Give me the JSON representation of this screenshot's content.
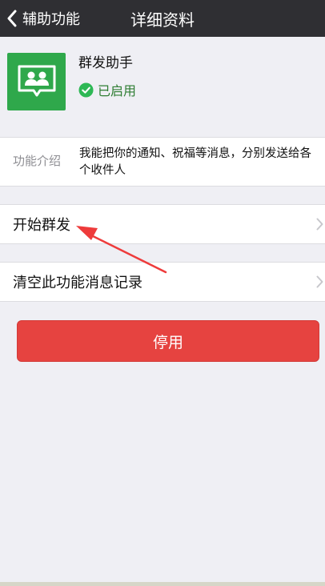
{
  "nav": {
    "back_label": "辅助功能",
    "title": "详细资料"
  },
  "profile": {
    "name": "群发助手",
    "status": "已启用",
    "icon": "group-chat-icon"
  },
  "intro": {
    "label": "功能介绍",
    "text": "我能把你的通知、祝福等消息，分别发送给各个收件人"
  },
  "rows": [
    {
      "label": "开始群发"
    },
    {
      "label": "清空此功能消息记录"
    }
  ],
  "actions": {
    "disable_label": "停用"
  },
  "colors": {
    "navbar": "#2f2f33",
    "background": "#efeff4",
    "app_icon": "#2fa84b",
    "status_check": "#2eb855",
    "disable_button": "#e64340",
    "annotation_arrow": "#ee3b3b"
  }
}
